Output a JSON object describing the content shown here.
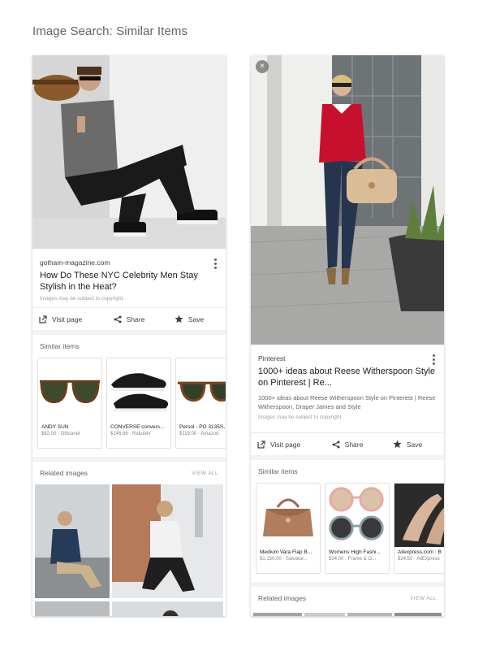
{
  "page_title": "Image Search: Similar Items",
  "left": {
    "source": "gotham-magazine.com",
    "headline": "How Do These NYC Celebrity Men Stay Stylish in the Heat?",
    "copyright": "Images may be subject to copyright.",
    "actions": {
      "visit": "Visit page",
      "share": "Share",
      "save": "Save"
    },
    "similar_label": "Similar items",
    "similar": [
      {
        "name": "ANDY SUN",
        "price": "$62.00 · Otticanet"
      },
      {
        "name": "CONVERSE convers...",
        "price": "$146.86 · Rakuten"
      },
      {
        "name": "Persol - PO 3135S,",
        "price": "$119.00 · Amazon."
      }
    ],
    "related_label": "Related images",
    "view_all": "VIEW ALL"
  },
  "right": {
    "close": "×",
    "source": "Pinterest",
    "headline": "1000+ ideas about Reese Witherspoon Style on Pinterest | Re...",
    "snippet": "1000+ ideas about Reese Witherspoon Style on Pinterest | Reese Witherspoon, Draper James and Style",
    "copyright": "Images may be subject to copyright.",
    "actions": {
      "visit": "Visit page",
      "share": "Share",
      "save": "Save"
    },
    "similar_label": "Similar items",
    "similar": [
      {
        "name": "Medium Vara Flap B...",
        "price": "$1,150.00 · Salvator..."
      },
      {
        "name": "Womens High Fashi...",
        "price": "$34.00 · Frame & O..."
      },
      {
        "name": "Aliexpress.com : B",
        "price": "$24.50 · AliExpress"
      }
    ],
    "related_label": "Related images",
    "view_all": "VIEW ALL"
  }
}
